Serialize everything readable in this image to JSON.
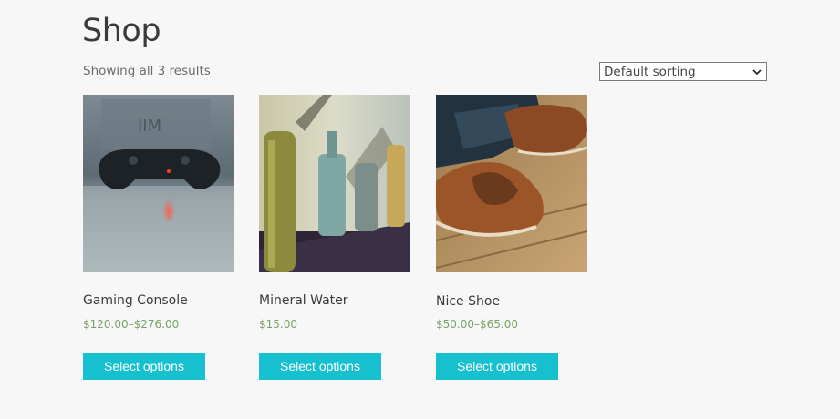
{
  "page": {
    "title": "Shop"
  },
  "toolbar": {
    "result_count": "Showing all 3 results",
    "sort_selected": "Default sorting",
    "sort_icon": "chevron-down-icon"
  },
  "products": [
    {
      "name": "Gaming Console",
      "price": "$120.00–$276.00",
      "button_label": "Select options",
      "image": "gamepad-photo"
    },
    {
      "name": "Mineral Water",
      "price": "$15.00",
      "button_label": "Select options",
      "image": "glass-bottles-photo"
    },
    {
      "name": "Nice Shoe",
      "price": "$50.00–$65.00",
      "button_label": "Select options",
      "image": "boat-shoes-photo"
    }
  ],
  "colors": {
    "background": "#f7f7f7",
    "button": "#16c0cf",
    "price": "#77a464",
    "text": "#3a3a3a"
  }
}
